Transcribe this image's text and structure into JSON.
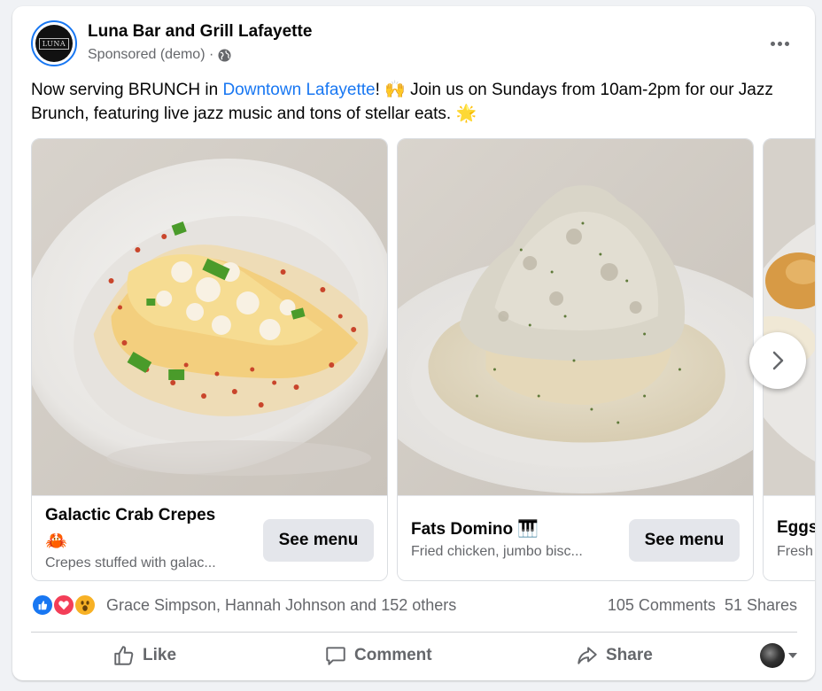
{
  "post": {
    "page_name": "Luna Bar and Grill Lafayette",
    "avatar_text": "LUNA",
    "sponsored_label": "Sponsored (demo) ·",
    "text_before_link": "Now serving BRUNCH in ",
    "link_text": "Downtown Lafayette",
    "text_after_link": "! 🙌 Join us on Sundays from 10am-2pm for our Jazz Brunch, featuring live jazz music and tons of stellar eats. 🌟"
  },
  "carousel": {
    "cards": [
      {
        "title": "Galactic Crab Crepes",
        "title_emoji": "🦀",
        "description": "Crepes stuffed with galac...",
        "button": "See menu"
      },
      {
        "title": "Fats Domino 🎹",
        "description": "Fried chicken, jumbo bisc...",
        "button": "See menu"
      },
      {
        "title": "Eggs",
        "description": "Fresh"
      }
    ]
  },
  "engagement": {
    "reaction_names": "Grace Simpson, Hannah Johnson and 152 others",
    "comments": "105 Comments",
    "shares": "51 Shares"
  },
  "actions": {
    "like": "Like",
    "comment": "Comment",
    "share": "Share"
  },
  "colors": {
    "accent": "#1877f2",
    "secondary_text": "#65676b",
    "button_bg": "#e4e6eb",
    "love": "#f33e58",
    "wow": "#f7b125"
  }
}
